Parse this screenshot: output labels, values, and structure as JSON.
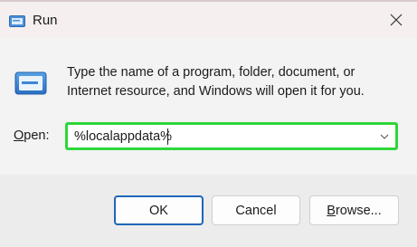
{
  "window": {
    "title": "Run",
    "close_label": "close"
  },
  "content": {
    "description": "Type the name of a program, folder, document, or Internet resource, and Windows will open it for you.",
    "open_label_accel": "O",
    "open_label_rest": "pen:",
    "open_value": "%localappdata%"
  },
  "buttons": {
    "ok": "OK",
    "cancel": "Cancel",
    "browse_accel": "B",
    "browse_rest": "rowse..."
  },
  "colors": {
    "accent": "#1f66b8",
    "highlight_border": "#2ed63a"
  },
  "icons": {
    "title": "run-icon",
    "main": "run-icon",
    "close": "close-icon",
    "dropdown": "chevron-down-icon"
  }
}
